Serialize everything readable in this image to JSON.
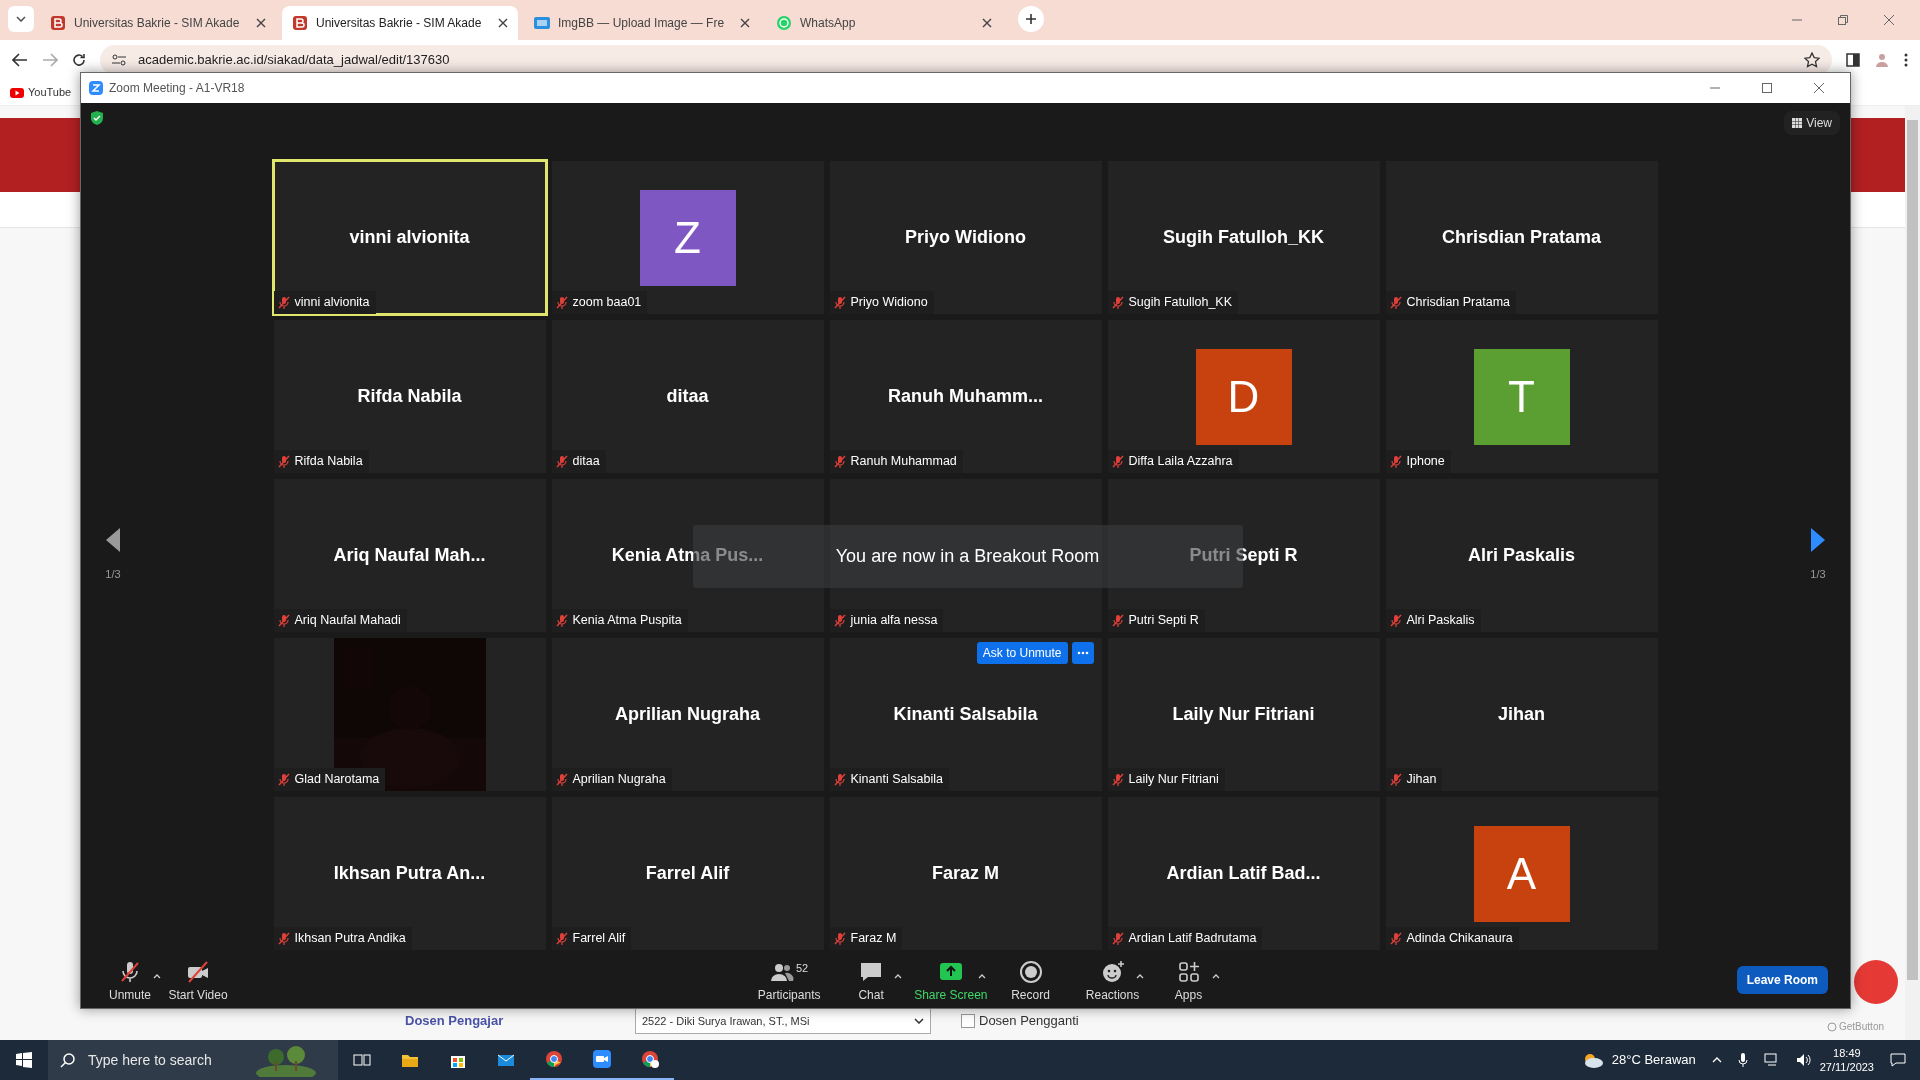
{
  "browser": {
    "tabs": [
      {
        "title": "Universitas Bakrie - SIM Akade",
        "selected": false
      },
      {
        "title": "Universitas Bakrie - SIM Akade",
        "selected": true
      },
      {
        "title": "ImgBB — Upload Image — Fre",
        "selected": false
      },
      {
        "title": "WhatsApp",
        "selected": false
      }
    ],
    "address": "academic.bakrie.ac.id/siakad/data_jadwal/edit/137630",
    "bookmarks": [
      {
        "label": "YouTube"
      }
    ]
  },
  "page": {
    "field_label": "Dosen Pengajar",
    "select_value": "2522 - Diki Surya Irawan, ST., MSi",
    "checkbox": {
      "label": "Dosen Pengganti",
      "checked": false
    },
    "widget_label": "GetButton"
  },
  "zoom": {
    "title": "Zoom Meeting - A1-VR18",
    "view_label": "View",
    "page_left": "1/3",
    "page_right": "1/3",
    "tiles": [
      {
        "kind": "name",
        "display_name": "vinni alvionita",
        "name_tag": "vinni alvionita",
        "muted": true,
        "highlighted": true
      },
      {
        "kind": "avatar",
        "letter": "Z",
        "color": "#7e57c2",
        "name_tag": "zoom baa01",
        "muted": true,
        "highlighted": false
      },
      {
        "kind": "name",
        "display_name": "Priyo Widiono",
        "name_tag": "Priyo Widiono",
        "muted": true,
        "highlighted": false
      },
      {
        "kind": "name",
        "display_name": "Sugih Fatulloh_KK",
        "name_tag": "Sugih Fatulloh_KK",
        "muted": true,
        "highlighted": false
      },
      {
        "kind": "name",
        "display_name": "Chrisdian Pratama",
        "name_tag": "Chrisdian Pratama",
        "muted": true,
        "highlighted": false
      },
      {
        "kind": "name",
        "display_name": "Rifda Nabila",
        "name_tag": "Rifda Nabila",
        "muted": true,
        "highlighted": false
      },
      {
        "kind": "name",
        "display_name": "ditaa",
        "name_tag": "ditaa",
        "muted": true,
        "highlighted": false
      },
      {
        "kind": "name",
        "display_name": "Ranuh Muhamm...",
        "name_tag": "Ranuh Muhammad",
        "muted": true,
        "highlighted": false
      },
      {
        "kind": "avatar",
        "letter": "D",
        "color": "#c7420f",
        "name_tag": "Diffa Laila Azzahra",
        "muted": true,
        "highlighted": false
      },
      {
        "kind": "avatar",
        "letter": "T",
        "color": "#5b9e32",
        "name_tag": "Iphone",
        "muted": true,
        "highlighted": false
      },
      {
        "kind": "name",
        "display_name": "Ariq Naufal Mah...",
        "name_tag": "Ariq Naufal Mahadi",
        "muted": true,
        "highlighted": false
      },
      {
        "kind": "name",
        "display_name": "Kenia Atma Pus...",
        "name_tag": "Kenia Atma Puspita",
        "muted": true,
        "highlighted": false
      },
      {
        "kind": "name",
        "name_tag": "junia alfa nessa",
        "muted": true,
        "highlighted": false
      },
      {
        "kind": "name",
        "display_name": "Putri Septi R",
        "name_tag": "Putri Septi R",
        "muted": true,
        "highlighted": false
      },
      {
        "kind": "name",
        "display_name": "Alri Paskalis",
        "name_tag": "Alri Paskalis",
        "muted": true,
        "highlighted": false
      },
      {
        "kind": "video",
        "name_tag": "Glad Narotama",
        "muted": true,
        "highlighted": false
      },
      {
        "kind": "name",
        "display_name": "Aprilian Nugraha",
        "name_tag": "Aprilian Nugraha",
        "muted": true,
        "highlighted": false
      },
      {
        "kind": "name",
        "display_name": "Kinanti Salsabila",
        "name_tag": "Kinanti Salsabila",
        "muted": true,
        "highlighted": false,
        "action_button": "Ask to Unmute"
      },
      {
        "kind": "name",
        "display_name": "Laily Nur Fitriani",
        "name_tag": "Laily Nur Fitriani",
        "muted": true,
        "highlighted": false
      },
      {
        "kind": "name",
        "display_name": "Jihan",
        "name_tag": "Jihan",
        "muted": true,
        "highlighted": false
      },
      {
        "kind": "name",
        "display_name": "Ikhsan Putra An...",
        "name_tag": "Ikhsan Putra Andika",
        "muted": true,
        "highlighted": false
      },
      {
        "kind": "name",
        "display_name": "Farrel Alif",
        "name_tag": "Farrel Alif",
        "muted": true,
        "highlighted": false
      },
      {
        "kind": "name",
        "display_name": "Faraz M",
        "name_tag": "Faraz M",
        "muted": true,
        "highlighted": false
      },
      {
        "kind": "name",
        "display_name": "Ardian Latif Bad...",
        "name_tag": "Ardian Latif Badrutama",
        "muted": true,
        "highlighted": false
      },
      {
        "kind": "avatar",
        "letter": "A",
        "color": "#c7420f",
        "name_tag": "Adinda Chikanaura",
        "muted": true,
        "highlighted": false
      }
    ],
    "toast": "You are now in a Breakout Room",
    "toolbar_left": [
      {
        "kind": "mic",
        "label": "Unmute",
        "has_menu": true
      },
      {
        "kind": "video",
        "label": "Start Video",
        "has_menu": false
      }
    ],
    "toolbar_center": [
      {
        "kind": "participants",
        "label": "Participants",
        "count": "52",
        "has_menu": false
      },
      {
        "kind": "chat",
        "label": "Chat",
        "has_menu": true
      },
      {
        "kind": "share",
        "label": "Share Screen",
        "has_menu": true
      },
      {
        "kind": "record",
        "label": "Record",
        "has_menu": false
      },
      {
        "kind": "reactions",
        "label": "Reactions",
        "has_menu": true
      },
      {
        "kind": "apps",
        "label": "Apps",
        "has_menu": true
      }
    ],
    "leave_label": "Leave Room"
  },
  "taskbar": {
    "search_placeholder": "Type here to search",
    "weather": "28°C Berawan",
    "time": "18:49",
    "date": "27/11/2023"
  }
}
